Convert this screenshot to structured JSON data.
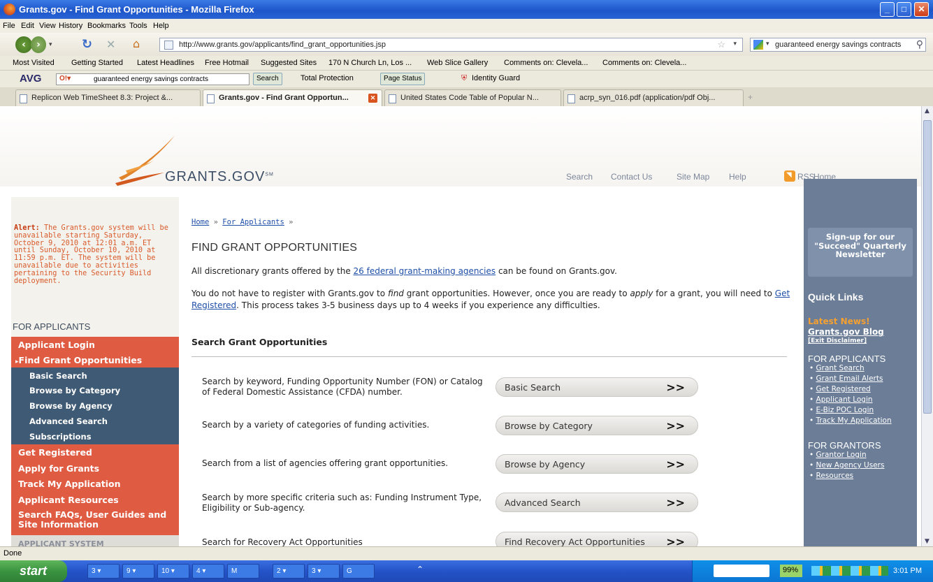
{
  "window": {
    "title": "Grants.gov - Find Grant Opportunities - Mozilla Firefox",
    "menu": [
      "File",
      "Edit",
      "View",
      "History",
      "Bookmarks",
      "Tools",
      "Help"
    ]
  },
  "nav": {
    "url": "http://www.grants.gov/applicants/find_grant_opportunities.jsp",
    "search_value": "guaranteed energy savings contracts"
  },
  "bookmarks": [
    "Most Visited",
    "Getting Started",
    "Latest Headlines",
    "Free Hotmail",
    "Suggested Sites",
    "170 N Church Ln, Los ...",
    "Web Slice Gallery",
    "Comments on: Clevela...",
    "Comments on: Clevela..."
  ],
  "avg": {
    "brand": "AVG",
    "search_value": "guaranteed energy savings contracts",
    "search_btn": "Search",
    "total_protection": "Total Protection",
    "page_status": "Page Status",
    "identity_guard": "Identity Guard"
  },
  "tabs": [
    {
      "label": "Replicon Web TimeSheet 8.3: Project &..."
    },
    {
      "label": "Grants.gov - Find Grant Opportun..."
    },
    {
      "label": "United States Code Table of Popular N..."
    },
    {
      "label": "acrp_syn_016.pdf (application/pdf Obj..."
    }
  ],
  "site": {
    "logo": "GRANTS.GOV",
    "logo_sm": "SM",
    "toplinks": [
      "Search",
      "Contact Us",
      "Site Map",
      "Help",
      "RSS",
      "Home"
    ]
  },
  "leftnav": {
    "alert_label": "Alert:",
    "alert_text": "The Grants.gov system will be unavailable starting Saturday, October 9, 2010 at 12:01 a.m. ET until Sunday, October 10, 2010 at 11:59 p.m. ET. The system will be unavailable due to activities pertaining to the Security Build deployment.",
    "heading": "FOR APPLICANTS",
    "items": [
      {
        "label": "Applicant Login"
      },
      {
        "label": "Find Grant Opportunities"
      },
      {
        "label": "Basic Search"
      },
      {
        "label": "Browse by Category"
      },
      {
        "label": "Browse by Agency"
      },
      {
        "label": "Advanced Search"
      },
      {
        "label": "Subscriptions"
      },
      {
        "label": "Get Registered"
      },
      {
        "label": "Apply for Grants"
      },
      {
        "label": "Track My Application"
      },
      {
        "label": "Applicant Resources"
      },
      {
        "label": "Search FAQs, User Guides and Site Information"
      },
      {
        "label": "APPLICANT SYSTEM"
      }
    ]
  },
  "main": {
    "breadcrumb": [
      "Home",
      "For Applicants"
    ],
    "breadcrumb_sep": "»",
    "title": "FIND GRANT OPPORTUNITIES",
    "p1_pre": "All discretionary grants offered by the",
    "p1_link": "26 federal grant-making agencies",
    "p1_post": "can be found on Grants.gov.",
    "p2_a": "You do not have to register with Grants.gov to",
    "p2_find": "find",
    "p2_b": "grant opportunities. However, once you are ready to",
    "p2_apply": "apply",
    "p2_c": "for a grant, you will need to",
    "p2_link": "Get Registered",
    "p2_d": ". This process takes 3-5 business days up to 4 weeks if you experience any difficulties.",
    "section_head": "Search Grant Opportunities",
    "rows": [
      {
        "desc": "Search by keyword, Funding Opportunity Number (FON) or Catalog of Federal Domestic Assistance (CFDA) number.",
        "btn": "Basic Search"
      },
      {
        "desc": "Search by a variety of categories of funding activities.",
        "btn": "Browse by Category"
      },
      {
        "desc": "Search from a list of agencies offering grant opportunities.",
        "btn": "Browse by Agency"
      },
      {
        "desc": "Search by more specific criteria such as: Funding Instrument Type, Eligibility or Sub-agency.",
        "btn": "Advanced Search"
      },
      {
        "desc": "Search for Recovery Act Opportunities",
        "btn": "Find Recovery Act Opportunities"
      }
    ],
    "arrow": ">>"
  },
  "rightside": {
    "signup": "Sign-up for our \"Succeed\" Quarterly Newsletter",
    "quick_links": "Quick Links",
    "latest_news": "Latest News!",
    "blog": "Grants.gov Blog",
    "exit": "[Exit Disclaimer]",
    "applicants_head": "FOR APPLICANTS",
    "applicants": [
      "Grant Search",
      "Grant Email Alerts",
      "Get Registered",
      "Applicant Login",
      "E-Biz POC Login",
      "Track My Application"
    ],
    "grantors_head": "FOR GRANTORS",
    "grantors": [
      "Grantor Login",
      "New Agency Users",
      "Resources"
    ]
  },
  "status": "Done",
  "taskbar": {
    "start": "start",
    "items": [
      "3 ▾",
      "9 ▾",
      "10 ▾",
      "4 ▾",
      "M",
      "2 ▾",
      "3 ▾",
      "G"
    ],
    "zoom": "99%",
    "clock": "3:01 PM"
  }
}
